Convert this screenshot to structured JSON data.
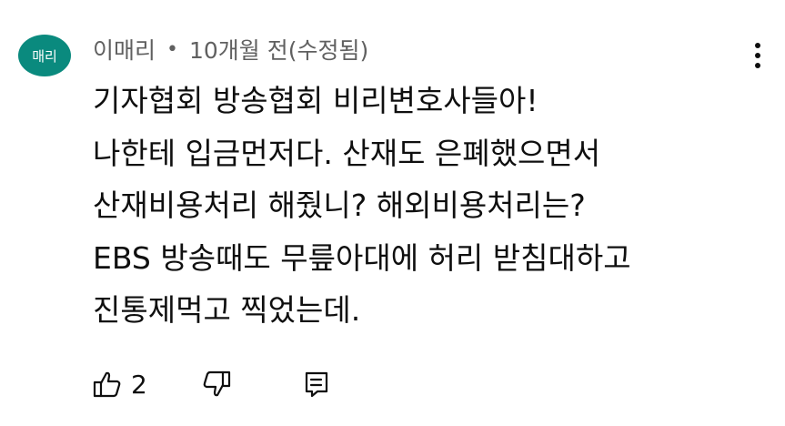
{
  "comment": {
    "avatar_text": "매리",
    "author": "이매리",
    "separator": "•",
    "time": "10개월 전",
    "edited": "(수정됨)",
    "lines": [
      "기자협회 방송협회 비리변호사들아!",
      "나한테 입금먼저다. 산재도 은폐했으면서",
      "산재비용처리 해줬니?  해외비용처리는?",
      "EBS 방송때도 무릎아대에 허리 받침대하고",
      "진통제먹고 찍었는데."
    ],
    "like_count": "2"
  },
  "colors": {
    "avatar_bg": "#0a8a7e",
    "meta_text": "#606060",
    "body_text": "#0f0f0f"
  },
  "icons": {
    "more": "more-vert-icon",
    "like": "thumb-up-icon",
    "dislike": "thumb-down-icon",
    "reply": "reply-icon"
  }
}
